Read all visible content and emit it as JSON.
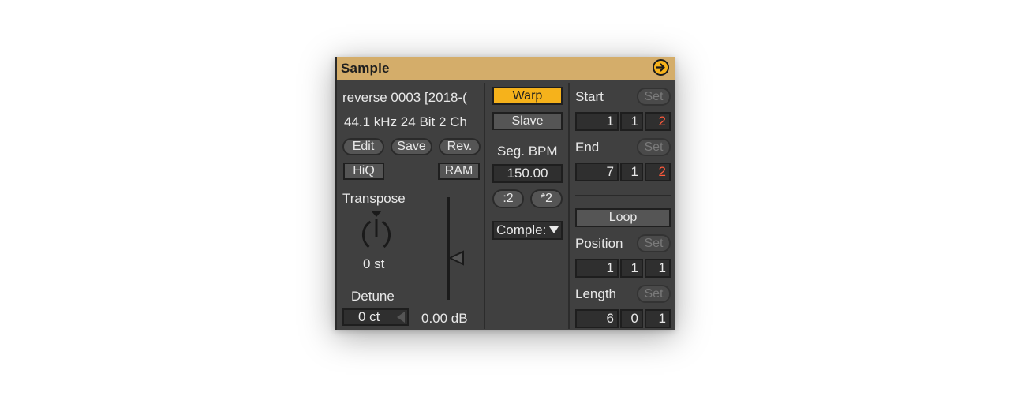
{
  "device": {
    "title": "Sample",
    "hotswap_icon": "arrow-right-circle-icon",
    "accent_color": "#f6b21b",
    "title_bar_color": "#d4ad6a",
    "panel_color": "#404040"
  },
  "sample_info": {
    "name": "reverse 0003 [2018-(",
    "format": "44.1 kHz 24 Bit 2 Ch",
    "edit_label": "Edit",
    "save_label": "Save",
    "rev_label": "Rev.",
    "hiq_label": "HiQ",
    "ram_label": "RAM"
  },
  "transpose": {
    "label": "Transpose",
    "value": "0 st",
    "knob_value_fraction": 0.5
  },
  "detune": {
    "label": "Detune",
    "value": "0 ct"
  },
  "volume": {
    "value": "0.00 dB"
  },
  "warp": {
    "warp_label": "Warp",
    "warp_on": true,
    "slave_label": "Slave",
    "seg_bpm_label": "Seg. BPM",
    "seg_bpm_value": "150.00",
    "half_label": ":2",
    "double_label": "*2",
    "mode_value": "Comple:",
    "mode_icon": "triangle-down-icon"
  },
  "markers": {
    "start": {
      "label": "Start",
      "set_label": "Set",
      "bars": "1",
      "beats": "1",
      "sixteenths": "2"
    },
    "end": {
      "label": "End",
      "set_label": "Set",
      "bars": "7",
      "beats": "1",
      "sixteenths": "2"
    },
    "loop_label": "Loop",
    "position": {
      "label": "Position",
      "set_label": "Set",
      "bars": "1",
      "beats": "1",
      "sixteenths": "1"
    },
    "length": {
      "label": "Length",
      "set_label": "Set",
      "bars": "6",
      "beats": "0",
      "sixteenths": "1"
    }
  }
}
